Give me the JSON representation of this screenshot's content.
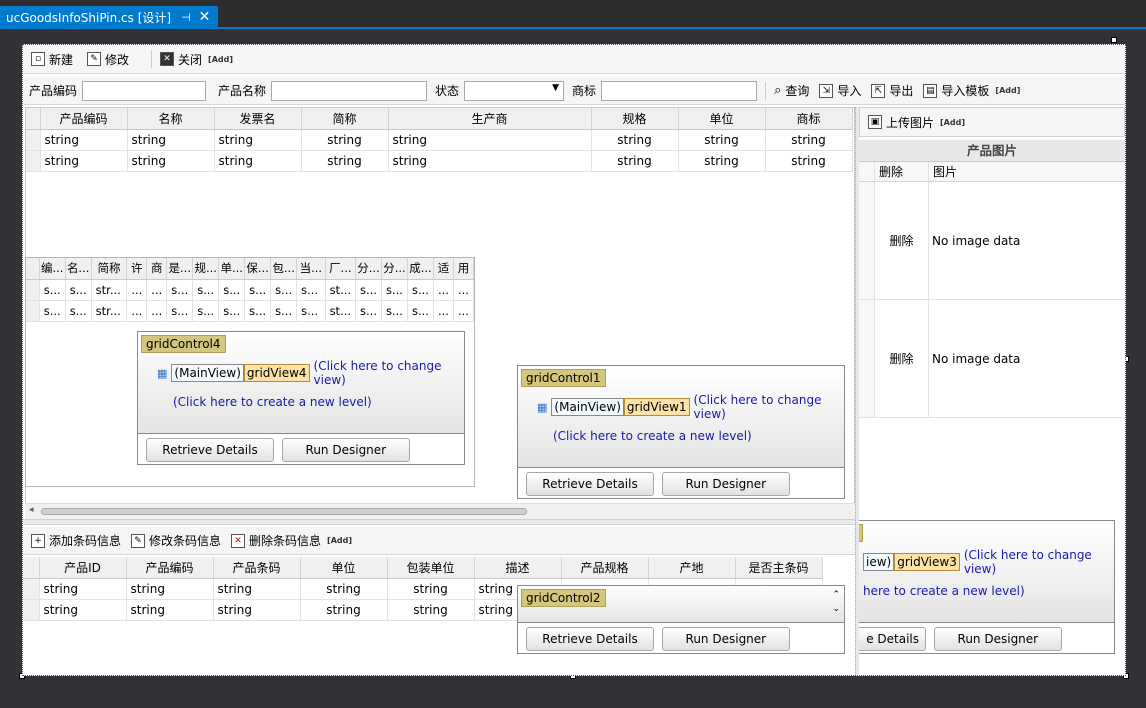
{
  "tab": {
    "title": "ucGoodsInfoShiPin.cs [设计]",
    "pin": "⊣",
    "close": "✕"
  },
  "toolbar": {
    "new": "新建",
    "edit": "修改",
    "close": "关闭",
    "add": "[Add]"
  },
  "filter": {
    "code_label": "产品编码",
    "name_label": "产品名称",
    "status_label": "状态",
    "brand_label": "商标",
    "query": "查询",
    "import": "导入",
    "export": "导出",
    "import_template": "导入模板",
    "add": "[Add]"
  },
  "main_grid": {
    "columns": [
      "产品编码",
      "名称",
      "发票名",
      "简称",
      "生产商",
      "规格",
      "单位",
      "商标"
    ],
    "rows": [
      [
        "string",
        "string",
        "string",
        "string",
        "string",
        "string",
        "string",
        "string"
      ],
      [
        "string",
        "string",
        "string",
        "string",
        "string",
        "string",
        "string",
        "string"
      ]
    ]
  },
  "mini_grid": {
    "columns": [
      "编...",
      "名...",
      "简称",
      "许",
      "商",
      "是...",
      "规...",
      "单...",
      "保...",
      "包...",
      "当...",
      "厂...",
      "分...",
      "分...",
      "成...",
      "适",
      "用"
    ],
    "rows": [
      [
        "s...",
        "s...",
        "str...",
        "...",
        "...",
        "s...",
        "s...",
        "s...",
        "s...",
        "s...",
        "s...",
        "st...",
        "s...",
        "s...",
        "s...",
        "...",
        "..."
      ],
      [
        "s...",
        "s...",
        "str...",
        "...",
        "...",
        "s...",
        "s...",
        "s...",
        "s...",
        "s...",
        "s...",
        "st...",
        "s...",
        "s...",
        "s...",
        "...",
        "..."
      ]
    ]
  },
  "gc4": {
    "title": "gridControl4",
    "main_view": "(MainView)",
    "view": "gridView4",
    "change": "(Click here to change view)",
    "new_level": "(Click here to create a new level)",
    "retrieve": "Retrieve Details",
    "designer": "Run Designer"
  },
  "gc1": {
    "title": "gridControl1",
    "main_view": "(MainView)",
    "view": "gridView1",
    "change": "(Click here to change view)",
    "new_level": "(Click here to create a new level)",
    "retrieve": "Retrieve Details",
    "designer": "Run Designer"
  },
  "gc2": {
    "title": "gridControl2",
    "retrieve": "Retrieve Details",
    "designer": "Run Designer"
  },
  "gc3": {
    "view_fragment": "iew)",
    "view": "gridView3",
    "change": "(Click here to change view)",
    "new_level": "here to create a new level)",
    "retrieve_fragment": "e Details",
    "designer": "Run Designer"
  },
  "right_panel": {
    "upload": "上传图片",
    "add": "[Add]",
    "title": "产品图片",
    "col_delete": "删除",
    "col_image": "图片",
    "rows": [
      {
        "delete": "删除",
        "image": "No image data"
      },
      {
        "delete": "删除",
        "image": "No image data"
      }
    ]
  },
  "barcode_toolbar": {
    "add": "添加条码信息",
    "edit": "修改条码信息",
    "delete": "删除条码信息",
    "add_tag": "[Add]"
  },
  "barcode_grid": {
    "columns": [
      "产品ID",
      "产品编码",
      "产品条码",
      "单位",
      "包装单位",
      "描述",
      "产品规格",
      "产地",
      "是否主条码"
    ],
    "rows": [
      [
        "string",
        "string",
        "string",
        "string",
        "string",
        "string"
      ],
      [
        "string",
        "string",
        "string",
        "string",
        "string",
        "string"
      ]
    ]
  }
}
